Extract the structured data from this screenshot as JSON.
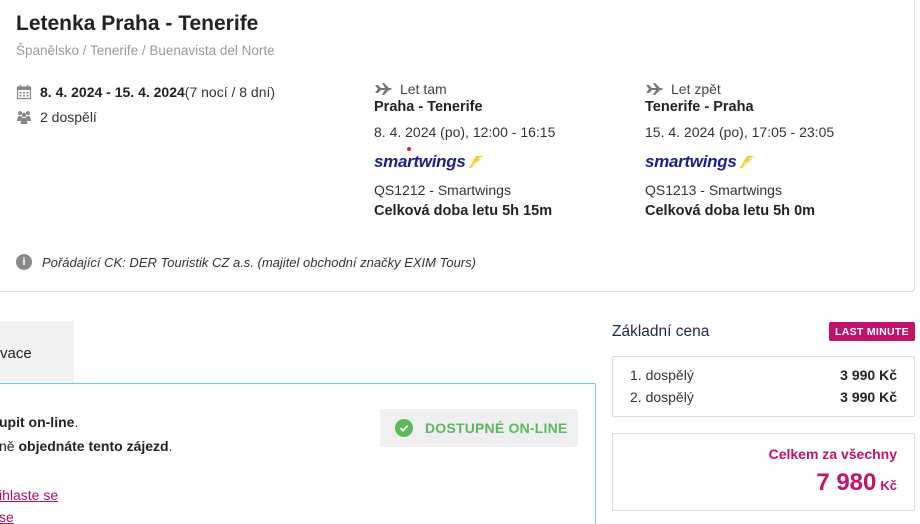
{
  "trip": {
    "title": "Letenka Praha - Tenerife",
    "breadcrumb": "Španělsko / Tenerife / Buenavista del Norte",
    "dates_bold": "8. 4. 2024 - 15. 4. 2024",
    "dates_rest": " (7 nocí / 8 dní)",
    "travelers": "2 dospělí"
  },
  "flights": [
    {
      "direction": "Let tam",
      "route": "Praha - Tenerife",
      "time": "8. 4. 2024 (po), 12:00 - 16:15",
      "airline_logo": "smartwings",
      "code": "QS1212 - Smartwings",
      "duration": "Celková doba letu 5h 15m"
    },
    {
      "direction": "Let zpět",
      "route": "Tenerife - Praha",
      "time": "15. 4. 2024 (po), 17:05 - 23:05",
      "airline_logo": "smartwings",
      "code": "QS1213 - Smartwings",
      "duration": "Celková doba letu 5h 0m"
    }
  ],
  "organizer": "Pořádající CK: DER Touristik CZ a.s. (majitel obchodní značky EXIM Tours)",
  "tabs": {
    "active_label": "vace"
  },
  "online": {
    "line1_bold": "upit on-line",
    "line1_rest": ".",
    "line2_prefix": "ně ",
    "line2_bold": "objednáte tento zájezd",
    "line2_rest": ".",
    "link1": "ihlaste se",
    "link2": "se",
    "badge": "DOSTUPNÉ ON-LINE"
  },
  "price": {
    "title": "Základní cena",
    "badge": "LAST MINUTE",
    "rows": [
      {
        "label": "1. dospělý",
        "amount": "3 990 Kč"
      },
      {
        "label": "2. dospělý",
        "amount": "3 990 Kč"
      }
    ],
    "total_label": "Celkem za všechny",
    "total_amount": "7 980",
    "total_currency": "Kč"
  },
  "colors": {
    "accent": "#c2126a",
    "airline_blue": "#1a1f8c",
    "online_green": "#5cb85c",
    "box_border_cyan": "#5bd3e0"
  },
  "icons": {
    "calendar": "calendar-icon",
    "people": "people-icon",
    "plane": "plane-icon",
    "info": "info-icon",
    "check": "check-icon"
  }
}
